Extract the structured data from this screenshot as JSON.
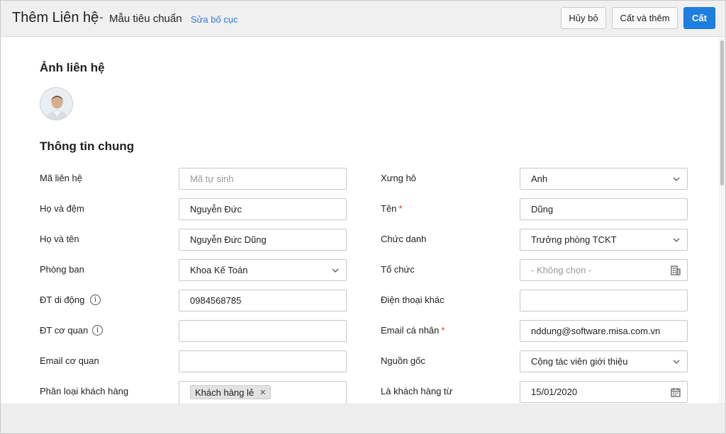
{
  "header": {
    "title": "Thêm Liên hệ",
    "separator": "-",
    "template": "Mẫu tiêu chuẩn",
    "edit_layout": "Sửa bố cục",
    "cancel_label": "Hủy bỏ",
    "save_add_label": "Cất và thêm",
    "save_label": "Cất"
  },
  "sections": {
    "photo_title": "Ảnh liên hệ",
    "general_title": "Thông tin chung"
  },
  "colors": {
    "primary": "#1f7fe0",
    "link": "#2f7ad8",
    "required": "#e53935"
  },
  "left_fields": [
    {
      "label": "Mã liên hệ",
      "value": "",
      "placeholder": "Mã tự sinh",
      "type": "text",
      "info": false
    },
    {
      "label": "Họ và đệm",
      "value": "Nguyễn Đức",
      "type": "text",
      "info": false
    },
    {
      "label": "Họ và tên",
      "value": "Nguyễn Đức Dũng",
      "type": "text",
      "info": false
    },
    {
      "label": "Phòng ban",
      "value": "Khoa Kế Toán",
      "type": "select",
      "info": false
    },
    {
      "label": "ĐT di động",
      "value": "0984568785",
      "type": "text",
      "info": true
    },
    {
      "label": "ĐT cơ quan",
      "value": "",
      "type": "text",
      "info": true
    },
    {
      "label": "Email cơ quan",
      "value": "",
      "type": "text",
      "info": false
    },
    {
      "label": "Phân loại khách hàng",
      "type": "tags",
      "tags": [
        "Khách hàng lẻ"
      ]
    }
  ],
  "right_fields": [
    {
      "label": "Xưng hô",
      "value": "Anh",
      "type": "select",
      "required": false
    },
    {
      "label": "Tên",
      "value": "Dũng",
      "type": "text",
      "required": true
    },
    {
      "label": "Chức danh",
      "value": "Trưởng phòng TCKT",
      "type": "select",
      "required": false
    },
    {
      "label": "Tổ chức",
      "value": "",
      "placeholder": "- Không chọn -",
      "type": "org",
      "required": false
    },
    {
      "label": "Điện thoại khác",
      "value": "",
      "type": "text",
      "required": false
    },
    {
      "label": "Email cá nhân",
      "value": "nddung@software.misa.com.vn",
      "type": "text",
      "required": true
    },
    {
      "label": "Nguồn gốc",
      "value": "Cộng tác viên giới thiệu",
      "type": "select",
      "required": false
    },
    {
      "label": "Là khách hàng từ",
      "value": "15/01/2020",
      "type": "date",
      "required": false
    }
  ],
  "icons": {
    "info": "info-icon",
    "chevron": "chevron-down-icon",
    "org": "building-icon",
    "date": "calendar-icon",
    "remove": "close-icon"
  }
}
